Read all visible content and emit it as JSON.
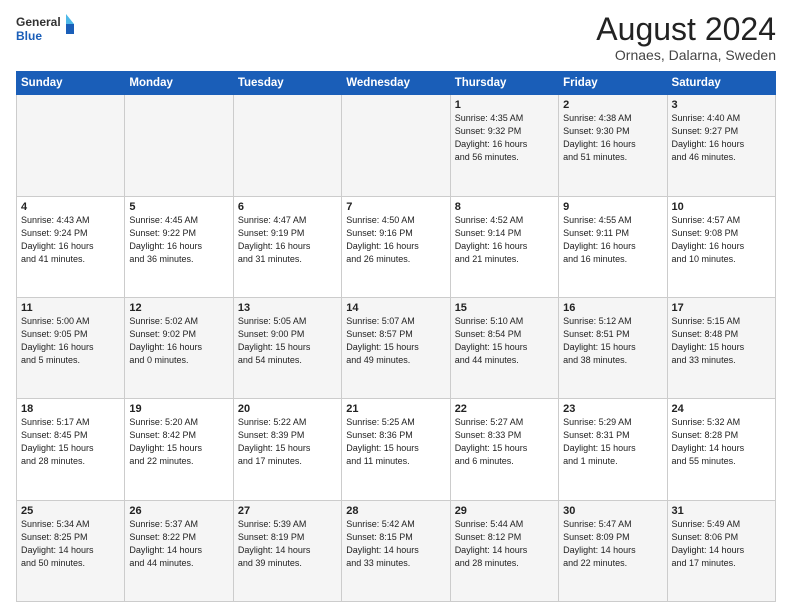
{
  "header": {
    "logo_line1": "General",
    "logo_line2": "Blue",
    "title": "August 2024",
    "subtitle": "Ornaes, Dalarna, Sweden"
  },
  "weekdays": [
    "Sunday",
    "Monday",
    "Tuesday",
    "Wednesday",
    "Thursday",
    "Friday",
    "Saturday"
  ],
  "weeks": [
    [
      {
        "day": "",
        "info": ""
      },
      {
        "day": "",
        "info": ""
      },
      {
        "day": "",
        "info": ""
      },
      {
        "day": "",
        "info": ""
      },
      {
        "day": "1",
        "info": "Sunrise: 4:35 AM\nSunset: 9:32 PM\nDaylight: 16 hours\nand 56 minutes."
      },
      {
        "day": "2",
        "info": "Sunrise: 4:38 AM\nSunset: 9:30 PM\nDaylight: 16 hours\nand 51 minutes."
      },
      {
        "day": "3",
        "info": "Sunrise: 4:40 AM\nSunset: 9:27 PM\nDaylight: 16 hours\nand 46 minutes."
      }
    ],
    [
      {
        "day": "4",
        "info": "Sunrise: 4:43 AM\nSunset: 9:24 PM\nDaylight: 16 hours\nand 41 minutes."
      },
      {
        "day": "5",
        "info": "Sunrise: 4:45 AM\nSunset: 9:22 PM\nDaylight: 16 hours\nand 36 minutes."
      },
      {
        "day": "6",
        "info": "Sunrise: 4:47 AM\nSunset: 9:19 PM\nDaylight: 16 hours\nand 31 minutes."
      },
      {
        "day": "7",
        "info": "Sunrise: 4:50 AM\nSunset: 9:16 PM\nDaylight: 16 hours\nand 26 minutes."
      },
      {
        "day": "8",
        "info": "Sunrise: 4:52 AM\nSunset: 9:14 PM\nDaylight: 16 hours\nand 21 minutes."
      },
      {
        "day": "9",
        "info": "Sunrise: 4:55 AM\nSunset: 9:11 PM\nDaylight: 16 hours\nand 16 minutes."
      },
      {
        "day": "10",
        "info": "Sunrise: 4:57 AM\nSunset: 9:08 PM\nDaylight: 16 hours\nand 10 minutes."
      }
    ],
    [
      {
        "day": "11",
        "info": "Sunrise: 5:00 AM\nSunset: 9:05 PM\nDaylight: 16 hours\nand 5 minutes."
      },
      {
        "day": "12",
        "info": "Sunrise: 5:02 AM\nSunset: 9:02 PM\nDaylight: 16 hours\nand 0 minutes."
      },
      {
        "day": "13",
        "info": "Sunrise: 5:05 AM\nSunset: 9:00 PM\nDaylight: 15 hours\nand 54 minutes."
      },
      {
        "day": "14",
        "info": "Sunrise: 5:07 AM\nSunset: 8:57 PM\nDaylight: 15 hours\nand 49 minutes."
      },
      {
        "day": "15",
        "info": "Sunrise: 5:10 AM\nSunset: 8:54 PM\nDaylight: 15 hours\nand 44 minutes."
      },
      {
        "day": "16",
        "info": "Sunrise: 5:12 AM\nSunset: 8:51 PM\nDaylight: 15 hours\nand 38 minutes."
      },
      {
        "day": "17",
        "info": "Sunrise: 5:15 AM\nSunset: 8:48 PM\nDaylight: 15 hours\nand 33 minutes."
      }
    ],
    [
      {
        "day": "18",
        "info": "Sunrise: 5:17 AM\nSunset: 8:45 PM\nDaylight: 15 hours\nand 28 minutes."
      },
      {
        "day": "19",
        "info": "Sunrise: 5:20 AM\nSunset: 8:42 PM\nDaylight: 15 hours\nand 22 minutes."
      },
      {
        "day": "20",
        "info": "Sunrise: 5:22 AM\nSunset: 8:39 PM\nDaylight: 15 hours\nand 17 minutes."
      },
      {
        "day": "21",
        "info": "Sunrise: 5:25 AM\nSunset: 8:36 PM\nDaylight: 15 hours\nand 11 minutes."
      },
      {
        "day": "22",
        "info": "Sunrise: 5:27 AM\nSunset: 8:33 PM\nDaylight: 15 hours\nand 6 minutes."
      },
      {
        "day": "23",
        "info": "Sunrise: 5:29 AM\nSunset: 8:31 PM\nDaylight: 15 hours\nand 1 minute."
      },
      {
        "day": "24",
        "info": "Sunrise: 5:32 AM\nSunset: 8:28 PM\nDaylight: 14 hours\nand 55 minutes."
      }
    ],
    [
      {
        "day": "25",
        "info": "Sunrise: 5:34 AM\nSunset: 8:25 PM\nDaylight: 14 hours\nand 50 minutes."
      },
      {
        "day": "26",
        "info": "Sunrise: 5:37 AM\nSunset: 8:22 PM\nDaylight: 14 hours\nand 44 minutes."
      },
      {
        "day": "27",
        "info": "Sunrise: 5:39 AM\nSunset: 8:19 PM\nDaylight: 14 hours\nand 39 minutes."
      },
      {
        "day": "28",
        "info": "Sunrise: 5:42 AM\nSunset: 8:15 PM\nDaylight: 14 hours\nand 33 minutes."
      },
      {
        "day": "29",
        "info": "Sunrise: 5:44 AM\nSunset: 8:12 PM\nDaylight: 14 hours\nand 28 minutes."
      },
      {
        "day": "30",
        "info": "Sunrise: 5:47 AM\nSunset: 8:09 PM\nDaylight: 14 hours\nand 22 minutes."
      },
      {
        "day": "31",
        "info": "Sunrise: 5:49 AM\nSunset: 8:06 PM\nDaylight: 14 hours\nand 17 minutes."
      }
    ]
  ]
}
